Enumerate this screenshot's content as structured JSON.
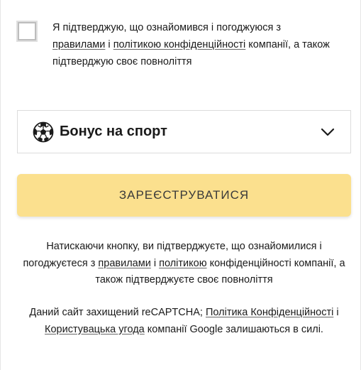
{
  "agreement": {
    "text_1": "Я підтверджую, що ознайомився і погоджуюся з",
    "link_rules": "правилами",
    "text_and": "і",
    "link_policy": "політикою конфіденційності",
    "text_2": "компанії, а також підтверджую своє повноліття",
    "checked": false
  },
  "bonus_select": {
    "icon": "soccer-ball-icon",
    "selected": "Бонус на спорт",
    "chevron": "chevron-down-icon"
  },
  "register_button": {
    "label": "ЗАРЕЄСТРУВАТИСЯ",
    "color": "#fbe08e"
  },
  "consent_notice": {
    "text_1": "Натискаючи кнопку, ви підтверджуєте, що ознайомилися і погоджуєтеся з",
    "link_rules": "правилами",
    "text_and": "і",
    "link_policy": "політикою",
    "text_2": "конфіденційності компанії, а також підтверджуєте своє повноліття"
  },
  "recaptcha_notice": {
    "text_1": "Даний сайт захищений reCAPTCHA;",
    "link_privacy": "Політика Конфіденційності",
    "text_and": "і",
    "link_terms": "Користувацька угода",
    "text_2": "компанії Google залишаються в силі."
  }
}
